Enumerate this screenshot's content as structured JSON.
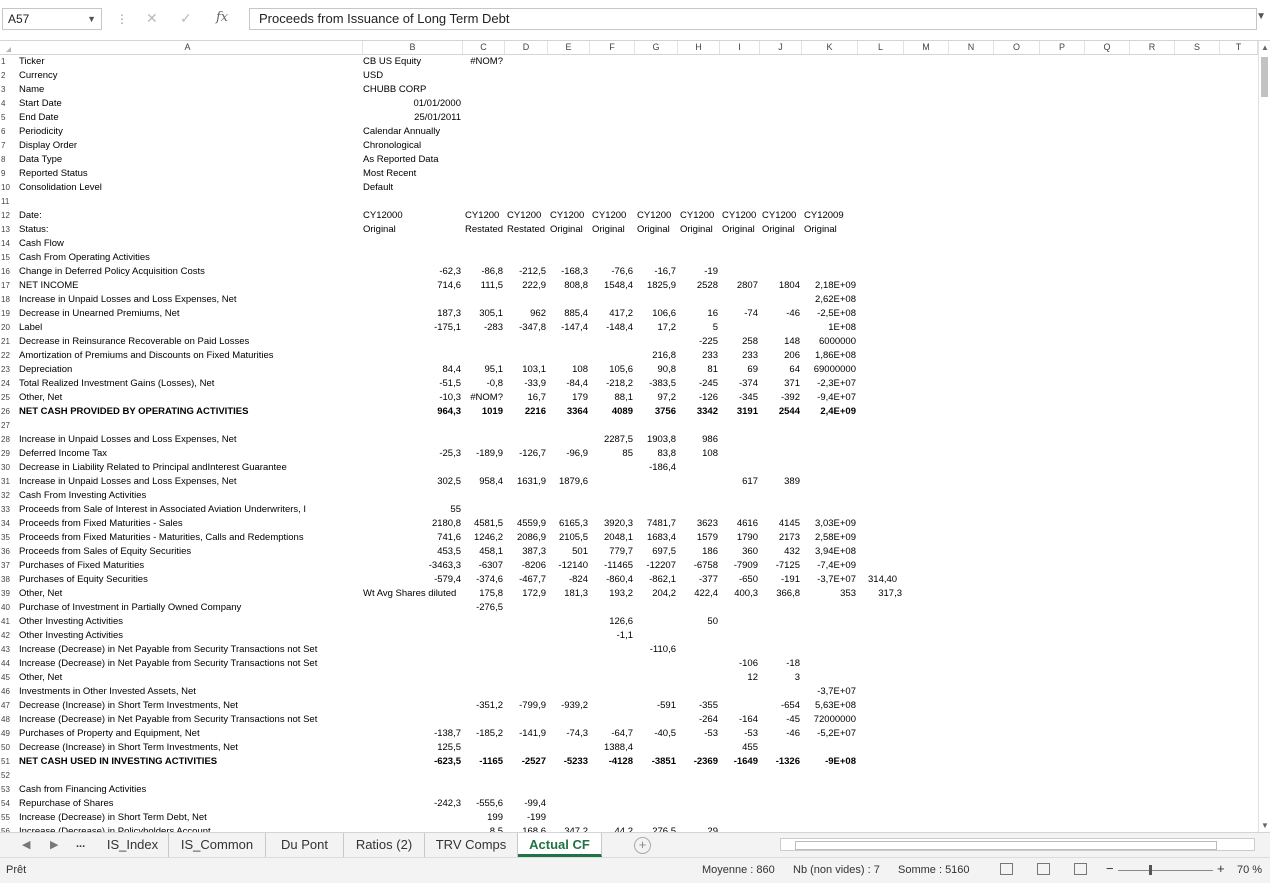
{
  "formula_bar": {
    "name_box": "A57",
    "cancel_symbol": "✕",
    "enter_symbol": "✓",
    "fx_symbol": "fx",
    "content": "Proceeds from Issuance of Long Term Debt"
  },
  "columns": [
    "A",
    "B",
    "C",
    "D",
    "E",
    "F",
    "G",
    "H",
    "I",
    "J",
    "K",
    "L",
    "M",
    "N",
    "O",
    "P",
    "Q",
    "R",
    "S",
    "T"
  ],
  "rows": [
    {
      "r": "1",
      "a": "Ticker",
      "b": "CB US Equity",
      "v": {
        "C": "#NOM?"
      }
    },
    {
      "r": "2",
      "a": "Currency",
      "b": "USD"
    },
    {
      "r": "3",
      "a": "Name",
      "b": "CHUBB CORP"
    },
    {
      "r": "4",
      "a": "Start Date",
      "b": "01/01/2000",
      "b_right": true
    },
    {
      "r": "5",
      "a": "End Date",
      "b": "25/01/2011",
      "b_right": true
    },
    {
      "r": "6",
      "a": "Periodicity",
      "b": "Calendar Annually"
    },
    {
      "r": "7",
      "a": "Display Order",
      "b": "Chronological"
    },
    {
      "r": "8",
      "a": "Data Type",
      "b": "As Reported Data"
    },
    {
      "r": "9",
      "a": "Reported Status",
      "b": "Most Recent"
    },
    {
      "r": "10",
      "a": "Consolidation Level",
      "b": "Default"
    },
    {
      "r": "11"
    },
    {
      "r": "12",
      "a": "Date:",
      "b": "CY12000",
      "t": {
        "C": "CY1200",
        "D": "CY1200",
        "E": "CY1200",
        "F": "CY1200",
        "G": "CY1200",
        "H": "CY1200",
        "I": "CY1200",
        "J": "CY1200",
        "K": "CY12009"
      }
    },
    {
      "r": "13",
      "a": "Status:",
      "b": "Original",
      "t": {
        "C": "Restated",
        "D": "Restated",
        "E": "Original",
        "F": "Original",
        "G": "Original",
        "H": "Original",
        "I": "Original",
        "J": "Original",
        "K": "Original"
      }
    },
    {
      "r": "14",
      "a": "Cash Flow"
    },
    {
      "r": "15",
      "a": "Cash From Operating Activities"
    },
    {
      "r": "16",
      "a": "Change in Deferred Policy Acquisition Costs",
      "v": {
        "B": "-62,3",
        "C": "-86,8",
        "D": "-212,5",
        "E": "-168,3",
        "F": "-76,6",
        "G": "-16,7",
        "H": "-19"
      }
    },
    {
      "r": "17",
      "a": "NET INCOME",
      "v": {
        "B": "714,6",
        "C": "111,5",
        "D": "222,9",
        "E": "808,8",
        "F": "1548,4",
        "G": "1825,9",
        "H": "2528",
        "I": "2807",
        "J": "1804",
        "K": "2,18E+09"
      }
    },
    {
      "r": "18",
      "a": "Increase in Unpaid Losses and Loss Expenses, Net",
      "v": {
        "K": "2,62E+08"
      }
    },
    {
      "r": "19",
      "a": "Decrease in Unearned Premiums, Net",
      "v": {
        "B": "187,3",
        "C": "305,1",
        "D": "962",
        "E": "885,4",
        "F": "417,2",
        "G": "106,6",
        "H": "16",
        "I": "-74",
        "J": "-46",
        "K": "-2,5E+08"
      }
    },
    {
      "r": "20",
      "a": "Label",
      "v": {
        "B": "-175,1",
        "C": "-283",
        "D": "-347,8",
        "E": "-147,4",
        "F": "-148,4",
        "G": "17,2",
        "H": "5",
        "K": "1E+08"
      }
    },
    {
      "r": "21",
      "a": "Decrease in Reinsurance Recoverable on Paid Losses",
      "v": {
        "H": "-225",
        "I": "258",
        "J": "148",
        "K": "6000000"
      }
    },
    {
      "r": "22",
      "a": "Amortization of Premiums and Discounts on Fixed Maturities",
      "v": {
        "G": "216,8",
        "H": "233",
        "I": "233",
        "J": "206",
        "K": "1,86E+08"
      }
    },
    {
      "r": "23",
      "a": "Depreciation",
      "v": {
        "B": "84,4",
        "C": "95,1",
        "D": "103,1",
        "E": "108",
        "F": "105,6",
        "G": "90,8",
        "H": "81",
        "I": "69",
        "J": "64",
        "K": "69000000"
      }
    },
    {
      "r": "24",
      "a": "Total Realized Investment Gains (Losses), Net",
      "v": {
        "B": "-51,5",
        "C": "-0,8",
        "D": "-33,9",
        "E": "-84,4",
        "F": "-218,2",
        "G": "-383,5",
        "H": "-245",
        "I": "-374",
        "J": "371",
        "K": "-2,3E+07"
      }
    },
    {
      "r": "25",
      "a": "Other, Net",
      "v": {
        "B": "-10,3",
        "C": "#NOM?",
        "D": "16,7",
        "E": "179",
        "F": "88,1",
        "G": "97,2",
        "H": "-126",
        "I": "-345",
        "J": "-392",
        "K": "-9,4E+07"
      }
    },
    {
      "r": "26",
      "a": "NET CASH PROVIDED BY OPERATING ACTIVITIES",
      "bold": true,
      "v": {
        "B": "964,3",
        "C": "1019",
        "D": "2216",
        "E": "3364",
        "F": "4089",
        "G": "3756",
        "H": "3342",
        "I": "3191",
        "J": "2544",
        "K": "2,4E+09"
      }
    },
    {
      "r": "27"
    },
    {
      "r": "28",
      "a": "Increase in Unpaid Losses and Loss Expenses, Net",
      "v": {
        "F": "2287,5",
        "G": "1903,8",
        "H": "986"
      }
    },
    {
      "r": "29",
      "a": "Deferred Income Tax",
      "v": {
        "B": "-25,3",
        "C": "-189,9",
        "D": "-126,7",
        "E": "-96,9",
        "F": "85",
        "G": "83,8",
        "H": "108"
      }
    },
    {
      "r": "30",
      "a": "Decrease in Liability Related to Principal andInterest Guarantee",
      "v": {
        "G": "-186,4"
      }
    },
    {
      "r": "31",
      "a": "Increase in Unpaid Losses and Loss Expenses, Net",
      "v": {
        "B": "302,5",
        "C": "958,4",
        "D": "1631,9",
        "E": "1879,6",
        "I": "617",
        "J": "389"
      }
    },
    {
      "r": "32",
      "a": "Cash From Investing Activities"
    },
    {
      "r": "33",
      "a": "Proceeds from Sale of Interest in Associated Aviation Underwriters, I",
      "v": {
        "B": "55"
      }
    },
    {
      "r": "34",
      "a": "Proceeds from Fixed Maturities - Sales",
      "v": {
        "B": "2180,8",
        "C": "4581,5",
        "D": "4559,9",
        "E": "6165,3",
        "F": "3920,3",
        "G": "7481,7",
        "H": "3623",
        "I": "4616",
        "J": "4145",
        "K": "3,03E+09"
      }
    },
    {
      "r": "35",
      "a": "Proceeds from Fixed Maturities - Maturities, Calls and Redemptions",
      "v": {
        "B": "741,6",
        "C": "1246,2",
        "D": "2086,9",
        "E": "2105,5",
        "F": "2048,1",
        "G": "1683,4",
        "H": "1579",
        "I": "1790",
        "J": "2173",
        "K": "2,58E+09"
      }
    },
    {
      "r": "36",
      "a": "Proceeds from Sales of Equity Securities",
      "v": {
        "B": "453,5",
        "C": "458,1",
        "D": "387,3",
        "E": "501",
        "F": "779,7",
        "G": "697,5",
        "H": "186",
        "I": "360",
        "J": "432",
        "K": "3,94E+08"
      }
    },
    {
      "r": "37",
      "a": "Purchases of Fixed Maturities",
      "v": {
        "B": "-3463,3",
        "C": "-6307",
        "D": "-8206",
        "E": "-12140",
        "F": "-11465",
        "G": "-12207",
        "H": "-6758",
        "I": "-7909",
        "J": "-7125",
        "K": "-7,4E+09"
      }
    },
    {
      "r": "38",
      "a": "Purchases of Equity Securities",
      "v": {
        "B": "-579,4",
        "C": "-374,6",
        "D": "-467,7",
        "E": "-824",
        "F": "-860,4",
        "G": "-862,1",
        "H": "-377",
        "I": "-650",
        "J": "-191",
        "K": "-3,7E+07"
      },
      "extra": [
        {
          "text": "314,40",
          "col": "L",
          "align": "left"
        }
      ]
    },
    {
      "r": "39",
      "a": "Other, Net",
      "b": "Wt Avg Shares diluted",
      "v": {
        "C": "175,8",
        "D": "172,9",
        "E": "181,3",
        "F": "193,2",
        "G": "204,2",
        "H": "422,4",
        "I": "400,3",
        "J": "366,8",
        "K": "353"
      },
      "extra": [
        {
          "text": "317,3",
          "col": "L",
          "align": "right"
        }
      ]
    },
    {
      "r": "40",
      "a": "Purchase of Investment in Partially Owned Company",
      "v": {
        "C": "-276,5"
      }
    },
    {
      "r": "41",
      "a": "Other Investing Activities",
      "v": {
        "F": "126,6",
        "H": "50"
      }
    },
    {
      "r": "42",
      "a": "Other Investing Activities",
      "v": {
        "F": "-1,1"
      }
    },
    {
      "r": "43",
      "a": "Increase (Decrease) in Net Payable from Security Transactions not Set",
      "v": {
        "G": "-110,6"
      }
    },
    {
      "r": "44",
      "a": "Increase (Decrease) in Net Payable from Security Transactions not Set",
      "v": {
        "I": "-106",
        "J": "-18"
      }
    },
    {
      "r": "45",
      "a": "Other, Net",
      "v": {
        "I": "12",
        "J": "3"
      }
    },
    {
      "r": "46",
      "a": "Investments in Other Invested Assets, Net",
      "v": {
        "K": "-3,7E+07"
      }
    },
    {
      "r": "47",
      "a": "Decrease (Increase) in Short Term Investments, Net",
      "v": {
        "C": "-351,2",
        "D": "-799,9",
        "E": "-939,2",
        "G": "-591",
        "H": "-355",
        "J": "-654",
        "K": "5,63E+08"
      }
    },
    {
      "r": "48",
      "a": "Increase (Decrease) in Net Payable from Security Transactions not Set",
      "v": {
        "H": "-264",
        "I": "-164",
        "J": "-45",
        "K": "72000000"
      }
    },
    {
      "r": "49",
      "a": "Purchases of Property and Equipment, Net",
      "v": {
        "B": "-138,7",
        "C": "-185,2",
        "D": "-141,9",
        "E": "-74,3",
        "F": "-64,7",
        "G": "-40,5",
        "H": "-53",
        "I": "-53",
        "J": "-46",
        "K": "-5,2E+07"
      }
    },
    {
      "r": "50",
      "a": "Decrease (Increase) in Short Term Investments, Net",
      "v": {
        "B": "125,5",
        "F": "1388,4",
        "I": "455"
      }
    },
    {
      "r": "51",
      "a": "NET CASH USED IN INVESTING ACTIVITIES",
      "bold": true,
      "v": {
        "B": "-623,5",
        "C": "-1165",
        "D": "-2527",
        "E": "-5233",
        "F": "-4128",
        "G": "-3851",
        "H": "-2369",
        "I": "-1649",
        "J": "-1326",
        "K": "-9E+08"
      }
    },
    {
      "r": "52"
    },
    {
      "r": "53",
      "a": "Cash from Financing Activities"
    },
    {
      "r": "54",
      "a": "Repurchase of Shares",
      "v": {
        "B": "-242,3",
        "C": "-555,6",
        "D": "-99,4"
      }
    },
    {
      "r": "55",
      "a": "Increase (Decrease) in Short Term Debt, Net",
      "v": {
        "C": "199",
        "D": "-199"
      }
    },
    {
      "r": "56",
      "a": "Increase (Decrease) in Policyholders Account",
      "v": {
        "C": "8,5",
        "D": "168,6",
        "E": "347,2",
        "F": "44,2",
        "G": "276,5",
        "H": "29"
      }
    }
  ],
  "sheet_tabs": [
    "IS_Index",
    "IS_Common",
    "Du Pont",
    "Ratios (2)",
    "TRV Comps",
    "Actual CF"
  ],
  "active_tab": "Actual CF",
  "tab_nav": {
    "prev": "◀",
    "next": "▶",
    "more": "..."
  },
  "add_sheet_symbol": "+",
  "status_bar": {
    "ready": "Prêt",
    "average": "Moyenne : 860",
    "count": "Nb (non vides) : 7",
    "sum": "Somme : 5160",
    "zoom": "70 %"
  }
}
